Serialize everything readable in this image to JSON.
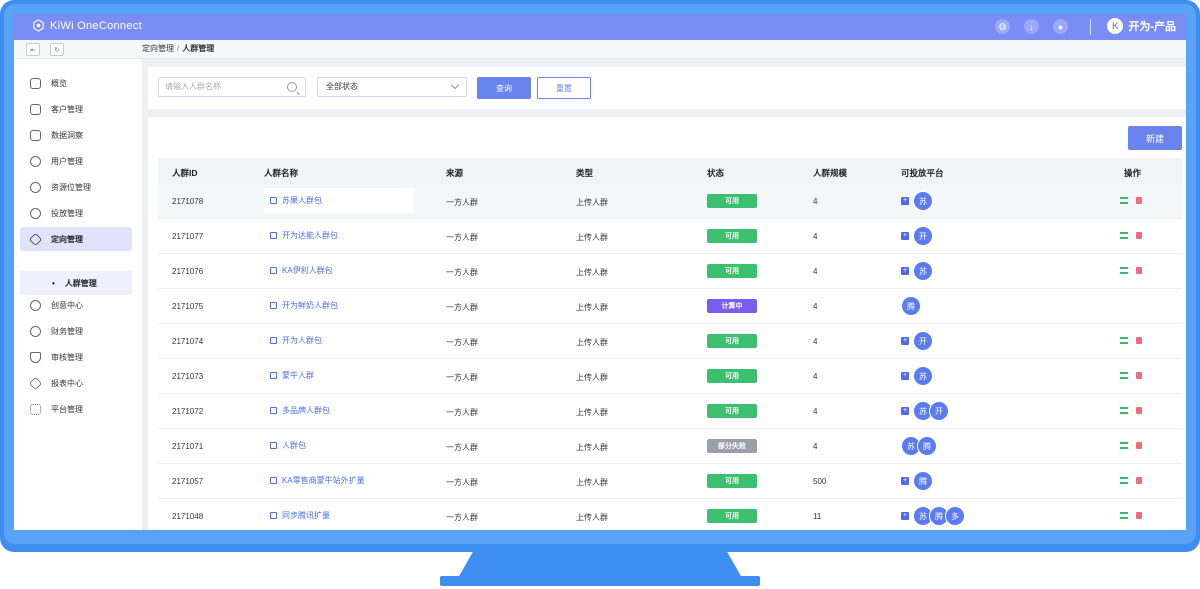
{
  "app": {
    "logo_text": "KiWi OneConnect",
    "user_name": "开为-产品",
    "user_initial": "K",
    "brand_color": "#7a8df4",
    "accent_color": "#6a84ee"
  },
  "header_icons": [
    "globe-icon",
    "download-icon",
    "notification-icon"
  ],
  "breadcrumb": {
    "parent": "定向管理",
    "current": "人群管理"
  },
  "sidebar": {
    "items": [
      {
        "label": "概览",
        "icon": "monitor-icon"
      },
      {
        "label": "客户管理",
        "icon": "cup-icon"
      },
      {
        "label": "数据洞察",
        "icon": "cast-icon"
      },
      {
        "label": "用户管理",
        "icon": "users-icon"
      },
      {
        "label": "资源位管理",
        "icon": "pie-icon"
      },
      {
        "label": "投放管理",
        "icon": "play-icon"
      },
      {
        "label": "定向管理",
        "icon": "layers-icon"
      },
      {
        "label": "创意中心",
        "icon": "smile-icon"
      },
      {
        "label": "财务管理",
        "icon": "target-icon"
      },
      {
        "label": "审核管理",
        "icon": "shield-icon"
      },
      {
        "label": "报表中心",
        "icon": "stack-icon"
      },
      {
        "label": "平台管理",
        "icon": "grid-icon"
      }
    ],
    "active_sub": "人群管理"
  },
  "filters": {
    "search_placeholder": "请输入人群名称",
    "status_select": "全部状态",
    "query_label": "查询",
    "reset_label": "重置"
  },
  "table": {
    "new_label": "新建",
    "headers": [
      "人群ID",
      "人群名称",
      "来源",
      "类型",
      "状态",
      "人群规模",
      "可投放平台",
      "操作"
    ],
    "rows": [
      {
        "id": "2171078",
        "name": "苏果人群包",
        "source": "一方人群",
        "type": "上传人群",
        "status": "可用",
        "status_color": "#3cbf6e",
        "size": "4",
        "plus": true,
        "platforms": [
          "苏"
        ],
        "ops": true
      },
      {
        "id": "2171077",
        "name": "开为达能人群包",
        "source": "一方人群",
        "type": "上传人群",
        "status": "可用",
        "status_color": "#3cbf6e",
        "size": "4",
        "plus": true,
        "platforms": [
          "开"
        ],
        "ops": true
      },
      {
        "id": "2171076",
        "name": "KA伊利人群包",
        "source": "一方人群",
        "type": "上传人群",
        "status": "可用",
        "status_color": "#3cbf6e",
        "size": "4",
        "plus": true,
        "platforms": [
          "苏"
        ],
        "ops": true
      },
      {
        "id": "2171075",
        "name": "开为鲜奶人群包",
        "source": "一方人群",
        "type": "上传人群",
        "status": "计算中",
        "status_color": "#7b5cf0",
        "size": "4",
        "plus": false,
        "platforms": [
          "腾"
        ],
        "ops": false
      },
      {
        "id": "2171074",
        "name": "开为人群包",
        "source": "一方人群",
        "type": "上传人群",
        "status": "可用",
        "status_color": "#3cbf6e",
        "size": "4",
        "plus": true,
        "platforms": [
          "开"
        ],
        "ops": true
      },
      {
        "id": "2171073",
        "name": "蒙牛人群",
        "source": "一方人群",
        "type": "上传人群",
        "status": "可用",
        "status_color": "#3cbf6e",
        "size": "4",
        "plus": true,
        "platforms": [
          "苏"
        ],
        "ops": true
      },
      {
        "id": "2171072",
        "name": "多品牌人群包",
        "source": "一方人群",
        "type": "上传人群",
        "status": "可用",
        "status_color": "#3cbf6e",
        "size": "4",
        "plus": true,
        "platforms": [
          "苏",
          "开"
        ],
        "ops": true
      },
      {
        "id": "2171071",
        "name": "人群包",
        "source": "一方人群",
        "type": "上传人群",
        "status": "部分失败",
        "status_color": "#9aa0aa",
        "size": "4",
        "plus": false,
        "platforms": [
          "苏",
          "腾"
        ],
        "ops": true
      },
      {
        "id": "2171057",
        "name": "KA零售商蒙牛站外扩量",
        "source": "一方人群",
        "type": "上传人群",
        "status": "可用",
        "status_color": "#3cbf6e",
        "size": "500",
        "plus": true,
        "platforms": [
          "腾"
        ],
        "ops": true
      },
      {
        "id": "2171048",
        "name": "同步腾讯扩量",
        "source": "一方人群",
        "type": "上传人群",
        "status": "可用",
        "status_color": "#3cbf6e",
        "size": "11",
        "plus": true,
        "platforms": [
          "苏",
          "腾",
          "多"
        ],
        "ops": true
      }
    ]
  }
}
